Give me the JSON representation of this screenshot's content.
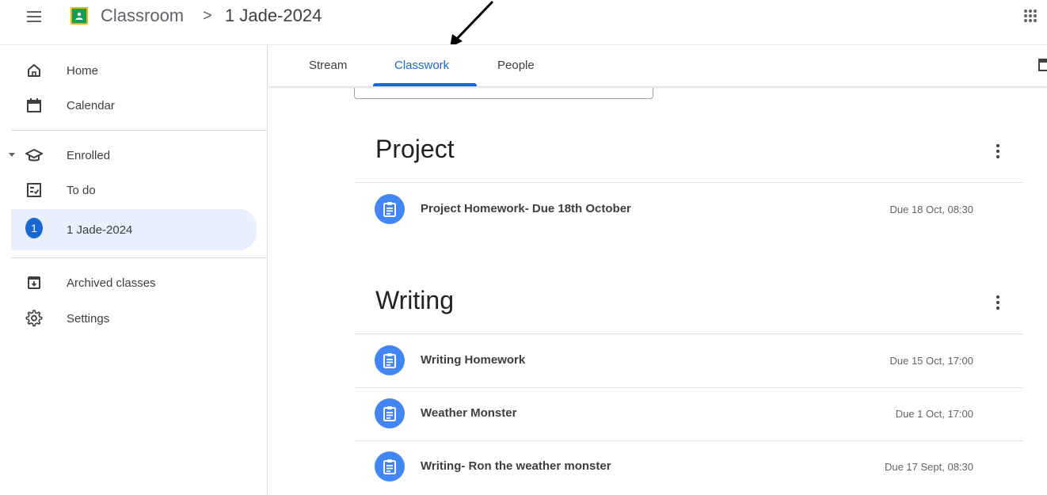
{
  "header": {
    "app_name": "Classroom",
    "separator": ">",
    "class_name": "1 Jade-2024"
  },
  "sidebar": {
    "items": [
      {
        "label": "Home",
        "icon": "home-icon"
      },
      {
        "label": "Calendar",
        "icon": "calendar-icon"
      },
      {
        "label": "Enrolled",
        "icon": "enrolled-icon"
      },
      {
        "label": "To do",
        "icon": "todo-icon"
      },
      {
        "label": "1 Jade-2024",
        "icon": "class-avatar",
        "badge": "1"
      },
      {
        "label": "Archived classes",
        "icon": "archive-icon"
      },
      {
        "label": "Settings",
        "icon": "settings-icon"
      }
    ]
  },
  "tabs": [
    {
      "label": "Stream"
    },
    {
      "label": "Classwork",
      "active": true
    },
    {
      "label": "People"
    }
  ],
  "topics": [
    {
      "title": "Project",
      "assignments": [
        {
          "title": "Project Homework- Due 18th October",
          "due": "Due 18 Oct, 08:30"
        }
      ]
    },
    {
      "title": "Writing",
      "assignments": [
        {
          "title": "Writing Homework",
          "due": "Due 15 Oct, 17:00"
        },
        {
          "title": "Weather Monster",
          "due": "Due 1 Oct, 17:00"
        },
        {
          "title": "Writing- Ron the weather monster",
          "due": "Due 17 Sept, 08:30"
        }
      ]
    }
  ],
  "colors": {
    "accent": "#1967d2",
    "assignment_icon_bg": "#4285f4",
    "active_nav_bg": "#e8f0fe",
    "logo_green": "#0f9d58",
    "logo_yellow": "#f4b400"
  }
}
